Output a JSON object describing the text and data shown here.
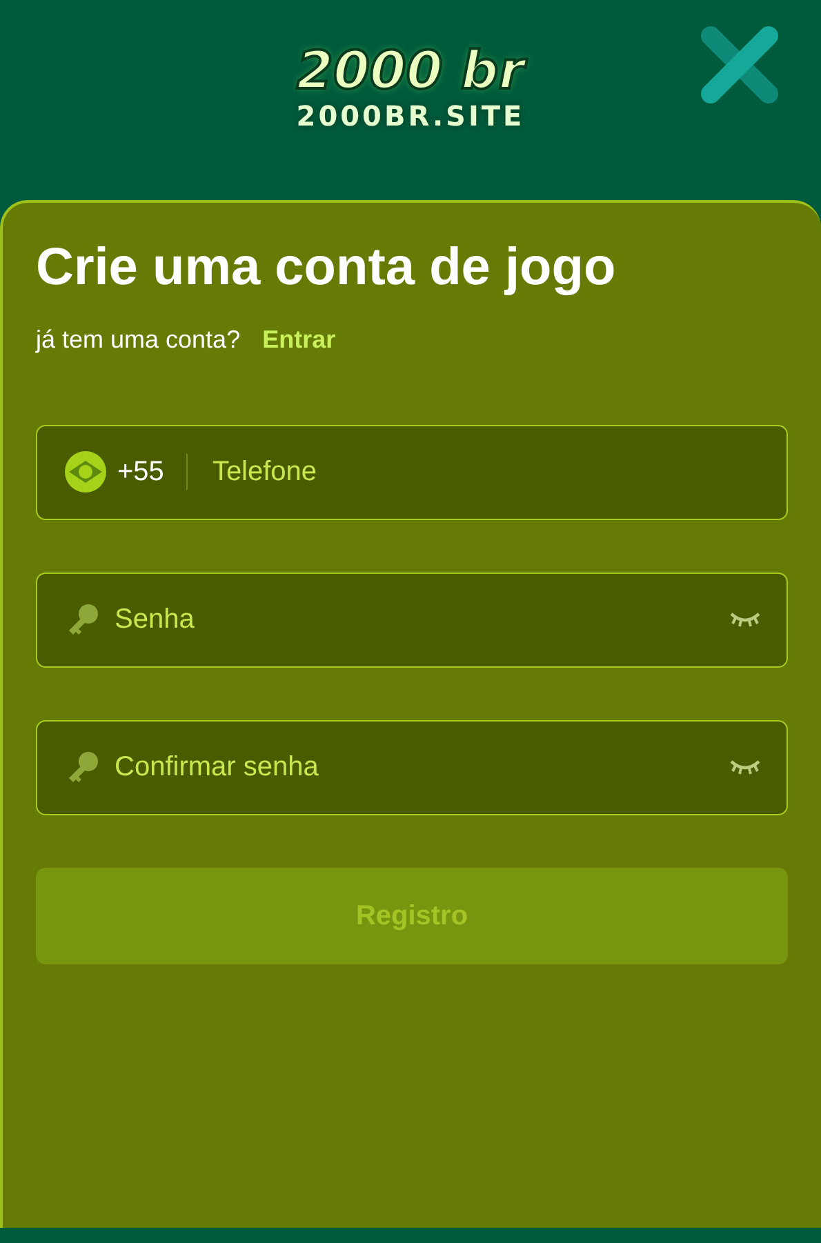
{
  "header": {
    "logo": "2000 br",
    "site": "2000BR.SITE"
  },
  "form": {
    "title": "Crie uma conta de jogo",
    "login_prompt": "já tem uma conta?",
    "login_link": "Entrar",
    "fields": [
      {
        "kind": "phone",
        "prefix": "+55",
        "placeholder": "Telefone"
      },
      {
        "kind": "password",
        "placeholder": "Senha"
      },
      {
        "kind": "password",
        "placeholder": "Confirmar senha"
      }
    ],
    "submit": {
      "label": "Registro",
      "disabled": true
    }
  }
}
